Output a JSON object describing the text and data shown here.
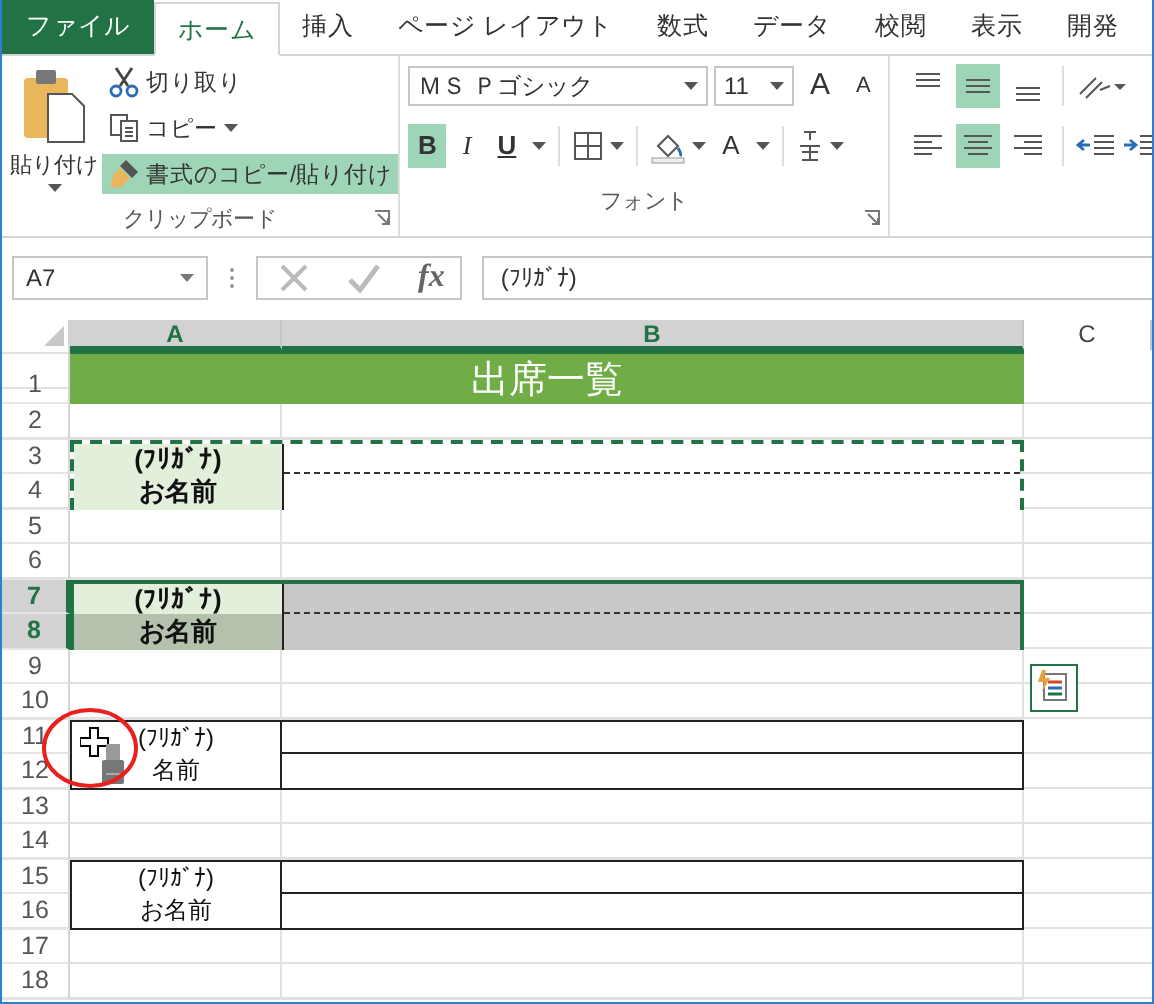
{
  "tabs": [
    {
      "label": "ファイル",
      "kind": "file",
      "selected": false
    },
    {
      "label": "ホーム",
      "kind": "tab",
      "selected": true
    },
    {
      "label": "挿入",
      "kind": "tab",
      "selected": false
    },
    {
      "label": "ページ レイアウト",
      "kind": "tab",
      "selected": false
    },
    {
      "label": "数式",
      "kind": "tab",
      "selected": false
    },
    {
      "label": "データ",
      "kind": "tab",
      "selected": false
    },
    {
      "label": "校閲",
      "kind": "tab",
      "selected": false
    },
    {
      "label": "表示",
      "kind": "tab",
      "selected": false
    },
    {
      "label": "開発",
      "kind": "tab",
      "selected": false
    }
  ],
  "clipboard": {
    "paste": "貼り付け",
    "cut": "切り取り",
    "copy": "コピー",
    "format_painter": {
      "label": "書式のコピー/貼り付け",
      "on": true
    },
    "label": "クリップボード"
  },
  "font": {
    "name": "ＭＳ Ｐゴシック",
    "size": "11",
    "grow": "A",
    "shrink": "A",
    "bold": {
      "label": "B",
      "on": true
    },
    "italic": {
      "label": "I",
      "on": false
    },
    "underline": {
      "label": "U",
      "on": false
    },
    "font_color": "A",
    "label": "フォント"
  },
  "alignment": {
    "vertical": [
      {
        "kind": "top",
        "selected": false
      },
      {
        "kind": "middle",
        "selected": true
      },
      {
        "kind": "bottom",
        "selected": false
      }
    ],
    "horizontal": [
      {
        "kind": "left",
        "selected": false
      },
      {
        "kind": "center",
        "selected": true
      },
      {
        "kind": "right",
        "selected": false
      }
    ]
  },
  "formula_bar": {
    "name_box": "A7",
    "fx": "fx",
    "formula": "(ﾌﾘｶﾞﾅ)"
  },
  "columns": [
    {
      "label": "A",
      "selected": true
    },
    {
      "label": "B",
      "selected": true
    },
    {
      "label": "C",
      "selected": false
    }
  ],
  "rows": [
    {
      "kind": "title",
      "number": "1",
      "text": "出席一覧"
    },
    {
      "kind": "blank",
      "number": "2"
    },
    {
      "kind": "form",
      "numbers": [
        "3",
        "4"
      ],
      "copy_marquee": true,
      "selected": false,
      "bold": true,
      "reading": "(ﾌﾘｶﾞﾅ)",
      "name": "お名前",
      "painter_cursor": false
    },
    {
      "kind": "blank",
      "number": "5"
    },
    {
      "kind": "blank",
      "number": "6"
    },
    {
      "kind": "form",
      "numbers": [
        "7",
        "8"
      ],
      "copy_marquee": false,
      "selected": true,
      "bold": true,
      "reading": "(ﾌﾘｶﾞﾅ)",
      "name": "お名前",
      "painter_cursor": false
    },
    {
      "kind": "blank",
      "number": "9",
      "quick_analysis": true
    },
    {
      "kind": "blank",
      "number": "10"
    },
    {
      "kind": "form",
      "numbers": [
        "11",
        "12"
      ],
      "copy_marquee": false,
      "selected": false,
      "bold": false,
      "reading": "(ﾌﾘｶﾞﾅ)",
      "name": "名前",
      "painter_cursor": true
    },
    {
      "kind": "blank",
      "number": "13"
    },
    {
      "kind": "blank",
      "number": "14"
    },
    {
      "kind": "form",
      "numbers": [
        "15",
        "16"
      ],
      "copy_marquee": false,
      "selected": false,
      "bold": false,
      "reading": "(ﾌﾘｶﾞﾅ)",
      "name": "お名前",
      "painter_cursor": false
    },
    {
      "kind": "blank",
      "number": "17"
    },
    {
      "kind": "blank",
      "number": "18"
    }
  ]
}
